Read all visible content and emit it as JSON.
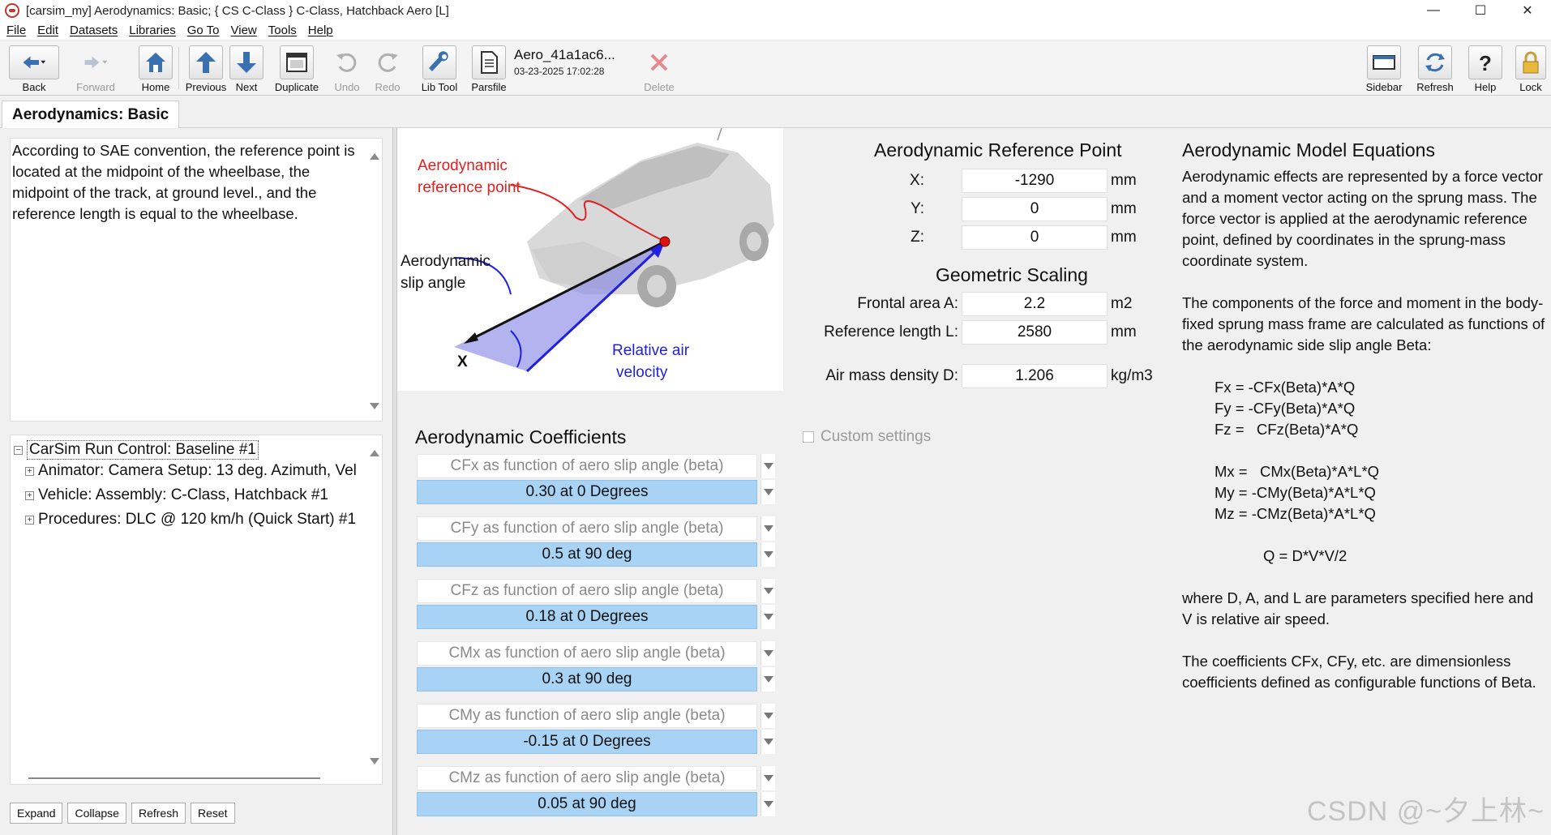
{
  "window": {
    "title": "[carsim_my] Aerodynamics: Basic; { CS C-Class } C-Class, Hatchback Aero [L]",
    "minimize": "—",
    "maximize": "☐",
    "close": "✕"
  },
  "menu": [
    "File",
    "Edit",
    "Datasets",
    "Libraries",
    "Go To",
    "View",
    "Tools",
    "Help"
  ],
  "toolbar": {
    "back": "Back",
    "forward": "Forward",
    "home": "Home",
    "previous": "Previous",
    "next": "Next",
    "duplicate": "Duplicate",
    "undo": "Undo",
    "redo": "Redo",
    "lib_tool": "Lib Tool",
    "parsfile": "Parsfile",
    "dataset_name": "Aero_41a1ac6...",
    "dataset_date": "03-23-2025 17:02:28",
    "delete": "Delete",
    "sidebar": "Sidebar",
    "refresh": "Refresh",
    "help": "Help",
    "lock": "Lock"
  },
  "tab": {
    "title": "Aerodynamics: Basic"
  },
  "description": "According to SAE convention, the reference point is located at the midpoint of the wheelbase, the midpoint of the track, at ground level., and the reference length is equal to the wheelbase.",
  "tree": {
    "root": "CarSim Run Control: Baseline #1",
    "root_toggle": "−",
    "children": [
      "Animator: Camera Setup: 13 deg. Azimuth, Vel",
      "Vehicle: Assembly: C-Class, Hatchback #1",
      "Procedures: DLC @ 120 km/h (Quick Start) #1"
    ],
    "child_toggle": "+"
  },
  "left_buttons": {
    "expand": "Expand",
    "collapse": "Collapse",
    "refresh": "Refresh",
    "reset": "Reset"
  },
  "diagram": {
    "ref_point_label_1": "Aerodynamic",
    "ref_point_label_2": "reference point",
    "slip_label_1": "Aerodynamic",
    "slip_label_2": "slip angle",
    "air_label_1": "Relative air",
    "air_label_2": "velocity",
    "x_label": "X"
  },
  "reference_point": {
    "title": "Aerodynamic Reference Point",
    "x_label": "X:",
    "x_value": "-1290",
    "x_unit": "mm",
    "y_label": "Y:",
    "y_value": "0",
    "y_unit": "mm",
    "z_label": "Z:",
    "z_value": "0",
    "z_unit": "mm"
  },
  "scaling": {
    "title": "Geometric Scaling",
    "area_label": "Frontal area A:",
    "area_value": "2.2",
    "area_unit": "m2",
    "length_label": "Reference length  L:",
    "length_value": "2580",
    "length_unit": "mm",
    "density_label": "Air mass density D:",
    "density_value": "1.206",
    "density_unit": "kg/m3"
  },
  "custom_settings": "Custom settings",
  "coefficients": {
    "title": "Aerodynamic Coefficients",
    "items": [
      {
        "label": "CFx as function of aero slip angle (beta)",
        "value": "0.30 at 0 Degrees"
      },
      {
        "label": "CFy as function of aero slip angle (beta)",
        "value": "0.5 at 90 deg"
      },
      {
        "label": "CFz as function of aero slip angle (beta)",
        "value": "0.18 at 0 Degrees"
      },
      {
        "label": "CMx as function of aero slip angle (beta)",
        "value": "0.3 at 90 deg"
      },
      {
        "label": "CMy as function of aero slip angle (beta)",
        "value": "-0.15 at 0 Degrees"
      },
      {
        "label": "CMz as function of aero slip angle (beta)",
        "value": "0.05 at 90 deg"
      }
    ]
  },
  "equations": {
    "title": "Aerodynamic Model Equations",
    "para1": "Aerodynamic effects are represented by a force vector and a moment vector acting on the sprung mass. The force vector is applied at the aerodynamic reference point, defined by coordinates in the sprung-mass coordinate system.",
    "para2": "The components of the force and moment in the body-fixed sprung mass frame are calculated as functions of the aerodynamic side slip angle Beta:",
    "fx": "Fx = -CFx(Beta)*A*Q",
    "fy": "Fy = -CFy(Beta)*A*Q",
    "fz": "Fz =   CFz(Beta)*A*Q",
    "mx": "Mx =   CMx(Beta)*A*L*Q",
    "my": "My = -CMy(Beta)*A*L*Q",
    "mz": "Mz = -CMz(Beta)*A*L*Q",
    "q": "Q = D*V*V/2",
    "para3": "where D, A, and L are parameters specified here and V is relative air speed.",
    "para4": "The coefficients CFx, CFy, etc. are dimensionless coefficients defined as configurable functions of Beta."
  },
  "watermark": "CSDN @~夕上林~"
}
